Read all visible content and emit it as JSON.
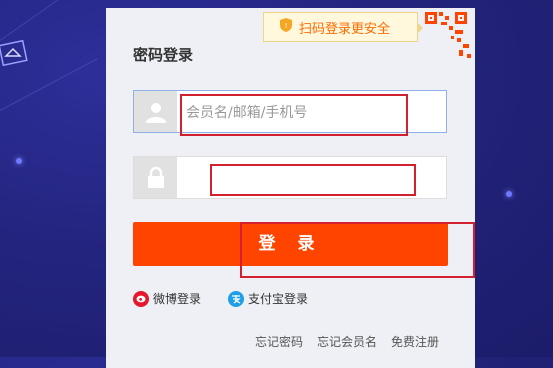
{
  "panel": {
    "title": "密码登录",
    "qr_tip": "扫码登录更安全",
    "username": {
      "value": "",
      "placeholder": "会员名/邮箱/手机号"
    },
    "password": {
      "value": ""
    },
    "login_button": "登 录",
    "alt_logins": [
      {
        "label": "微博登录",
        "icon": "weibo-icon",
        "color": "#e6162d"
      },
      {
        "label": "支付宝登录",
        "icon": "alipay-icon",
        "color": "#1e9fe8"
      }
    ],
    "links": [
      "忘记密码",
      "忘记会员名",
      "免费注册"
    ]
  },
  "colors": {
    "accent": "#ff4400",
    "highlight": "#d2202e",
    "background": "#23247e"
  }
}
